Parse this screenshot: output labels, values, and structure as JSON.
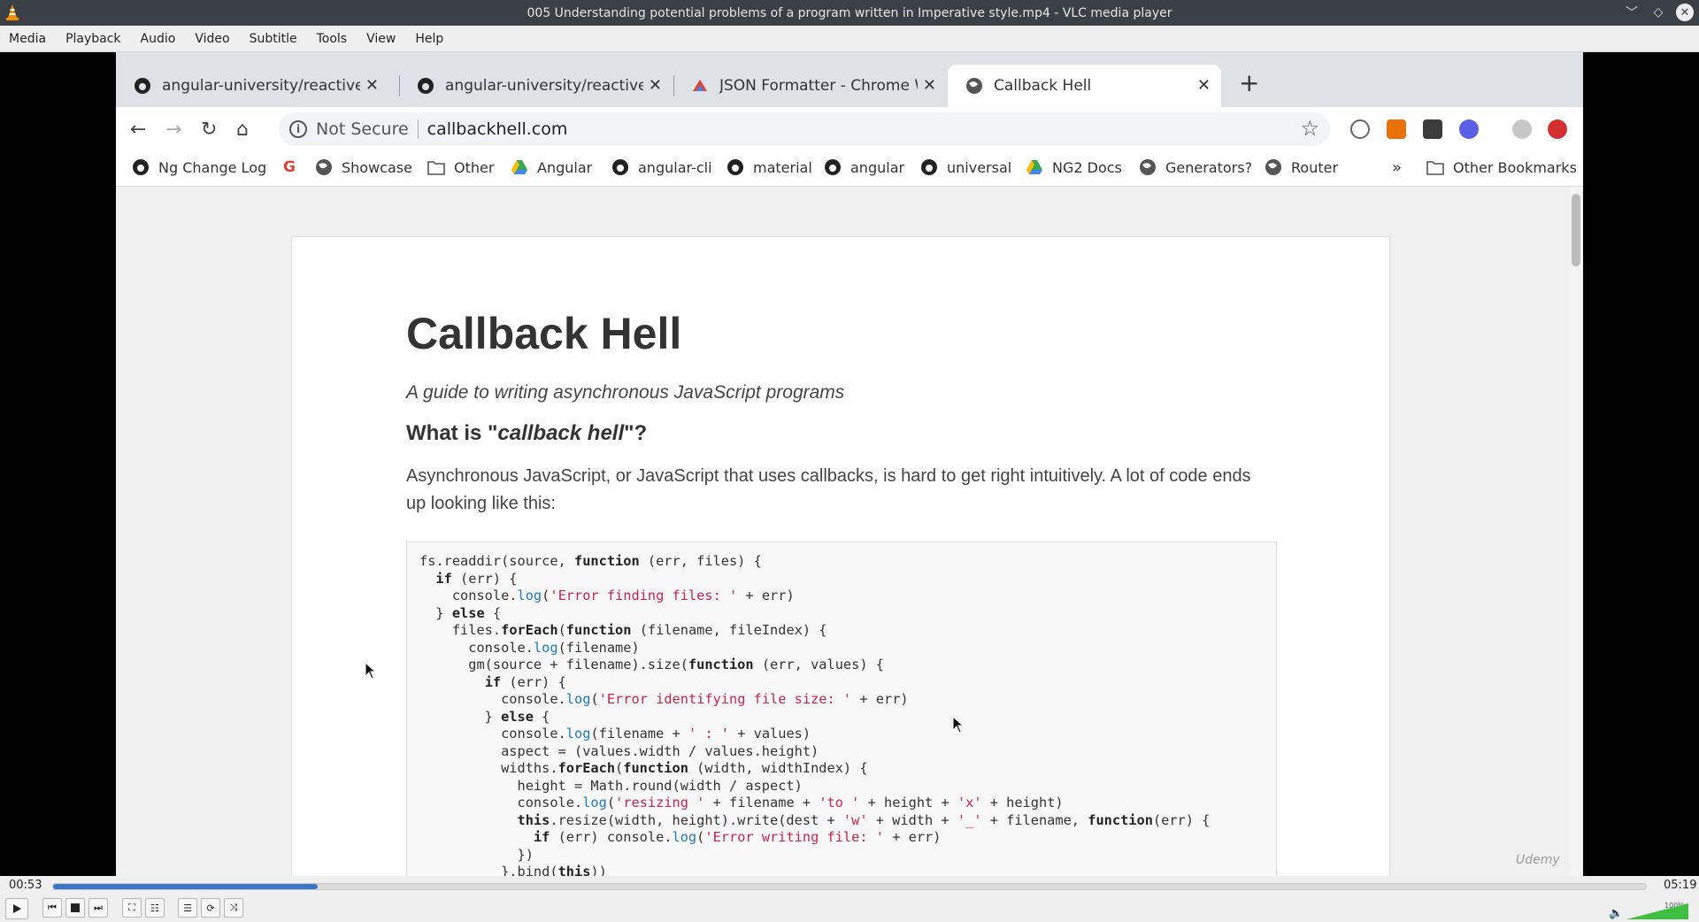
{
  "window": {
    "title": "005 Understanding potential problems of a program written in Imperative style.mp4 - VLC media player"
  },
  "menu": [
    "Media",
    "Playback",
    "Audio",
    "Video",
    "Subtitle",
    "Tools",
    "View",
    "Help"
  ],
  "browser": {
    "tabs": [
      {
        "label": "angular-university/reactive-an",
        "icon": "github-icon",
        "active": false
      },
      {
        "label": "angular-university/reactive-an",
        "icon": "github-icon",
        "active": false
      },
      {
        "label": "JSON Formatter - Chrome Web",
        "icon": "chrome-webstore-icon",
        "active": false
      },
      {
        "label": "Callback Hell",
        "icon": "globe-icon",
        "active": true
      }
    ],
    "omnibox": {
      "security": "Not Secure",
      "url": "callbackhell.com"
    },
    "bookmarks": [
      {
        "label": "Ng Change Log",
        "icon": "github-icon"
      },
      {
        "label": "",
        "icon": "google-icon"
      },
      {
        "label": "Showcase",
        "icon": "globe-icon"
      },
      {
        "label": "Other",
        "icon": "folder-icon"
      },
      {
        "label": "Angular",
        "icon": "drive-icon"
      },
      {
        "label": "angular-cli",
        "icon": "github-icon"
      },
      {
        "label": "material",
        "icon": "github-icon"
      },
      {
        "label": "angular",
        "icon": "github-icon"
      },
      {
        "label": "universal",
        "icon": "github-icon"
      },
      {
        "label": "NG2 Docs",
        "icon": "drive-icon"
      },
      {
        "label": "Generators?",
        "icon": "globe-icon"
      },
      {
        "label": "Router",
        "icon": "globe-icon"
      }
    ],
    "bookmarks_overflow": "»",
    "other_bookmarks": "Other Bookmarks"
  },
  "page": {
    "title": "Callback Hell",
    "subtitle": "A guide to writing asynchronous JavaScript programs",
    "heading_pre": "What is \"",
    "heading_em": "callback hell",
    "heading_post": "\"?",
    "paragraph": "Asynchronous JavaScript, or JavaScript that uses callbacks, is hard to get right intuitively. A lot of code ends up looking like this:"
  },
  "watermark": "Udemy",
  "player": {
    "elapsed": "00:53",
    "total": "05:19",
    "progress_fraction": 0.166,
    "volume": "100%"
  }
}
